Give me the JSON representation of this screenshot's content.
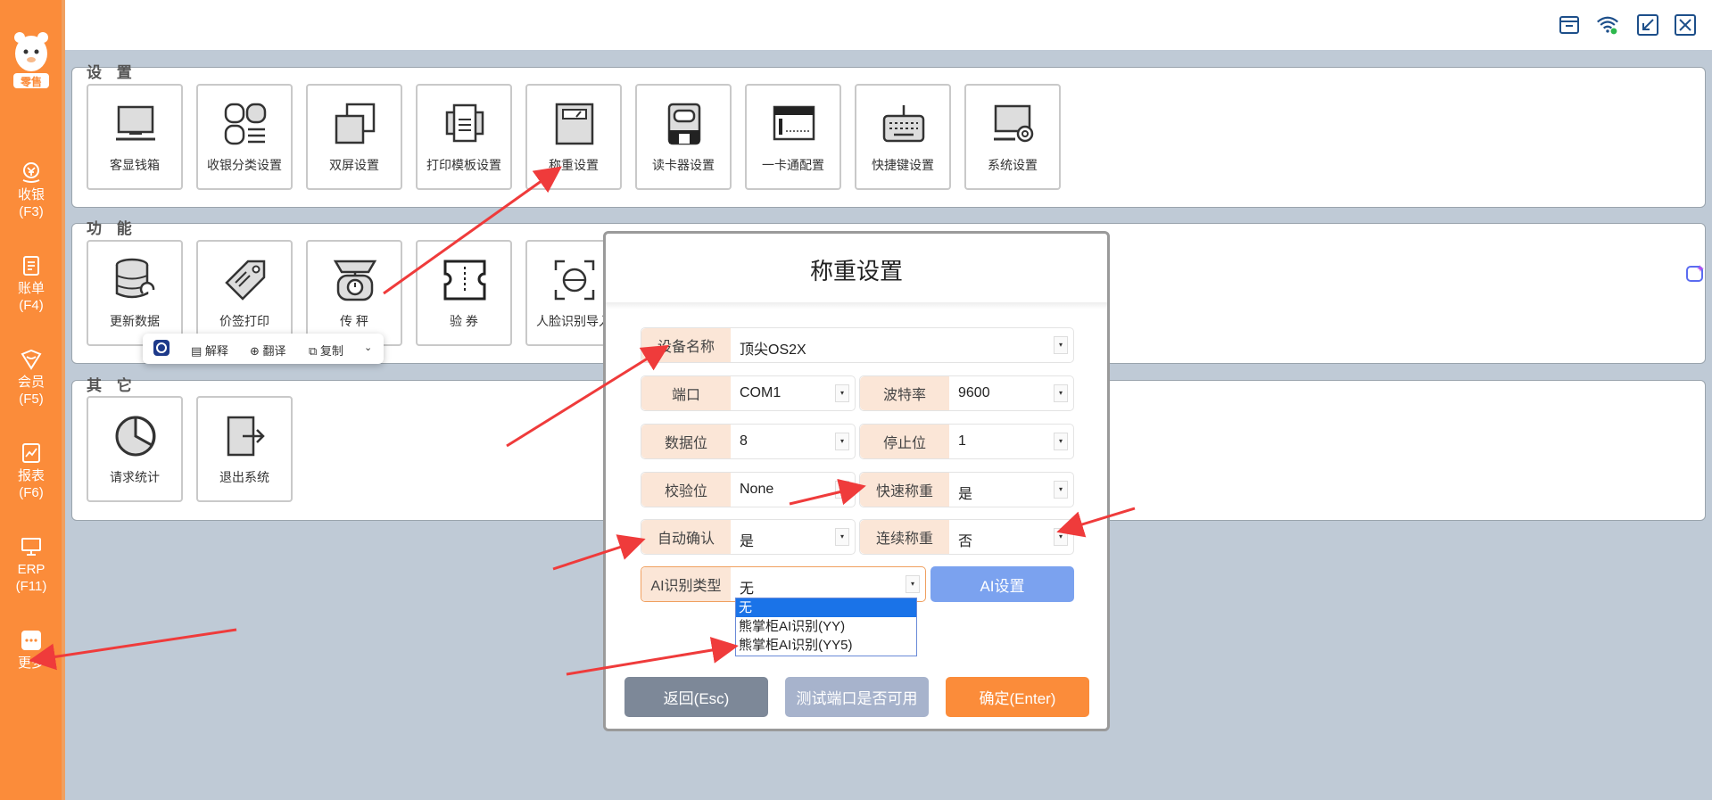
{
  "sidebar": {
    "logo_text": "零售",
    "items": [
      {
        "label": "收银",
        "key": "(F3)"
      },
      {
        "label": "账单",
        "key": "(F4)"
      },
      {
        "label": "会员",
        "key": "(F5)"
      },
      {
        "label": "报表",
        "key": "(F6)"
      },
      {
        "label": "ERP",
        "key": "(F11)"
      },
      {
        "label": "更多",
        "key": ""
      }
    ]
  },
  "sections": {
    "settings": {
      "title": "设 置",
      "tiles": [
        "客显钱箱",
        "收银分类设置",
        "双屏设置",
        "打印模板设置",
        "称重设置",
        "读卡器设置",
        "一卡通配置",
        "快捷键设置",
        "系统设置"
      ]
    },
    "functions": {
      "title": "功 能",
      "tiles": [
        "更新数据",
        "价签打印",
        "传 秤",
        "验 券",
        "人脸识别导入"
      ]
    },
    "others": {
      "title": "其 它",
      "tiles": [
        "请求统计",
        "退出系统"
      ]
    }
  },
  "toolbar_popup": {
    "explain": "解释",
    "translate": "翻译",
    "copy": "复制"
  },
  "dialog": {
    "title": "称重设置",
    "device_name": {
      "label": "设备名称",
      "value": "顶尖OS2X"
    },
    "port": {
      "label": "端口",
      "value": "COM1"
    },
    "baud": {
      "label": "波特率",
      "value": "9600"
    },
    "data_bits": {
      "label": "数据位",
      "value": "8"
    },
    "stop_bits": {
      "label": "停止位",
      "value": "1"
    },
    "parity": {
      "label": "校验位",
      "value": "None"
    },
    "fast_weigh": {
      "label": "快速称重",
      "value": "是"
    },
    "auto_confirm": {
      "label": "自动确认",
      "value": "是"
    },
    "continuous_weigh": {
      "label": "连续称重",
      "value": "否"
    },
    "ai_type": {
      "label": "AI识别类型",
      "value": "无",
      "options": [
        "无",
        "熊掌柜AI识别(YY)",
        "熊掌柜AI识别(YY5)"
      ]
    },
    "ai_settings_button": "AI设置",
    "back_button": "返回(Esc)",
    "test_port_button": "测试端口是否可用",
    "confirm_button": "确定(Enter)"
  },
  "colors": {
    "sidebar": "#fb8c3a",
    "accent_blue": "#7ba2ef",
    "confirm": "#fb8c3a",
    "back": "#7d8898",
    "test": "#a7b3cc",
    "arrow": "#ef3b3b"
  }
}
